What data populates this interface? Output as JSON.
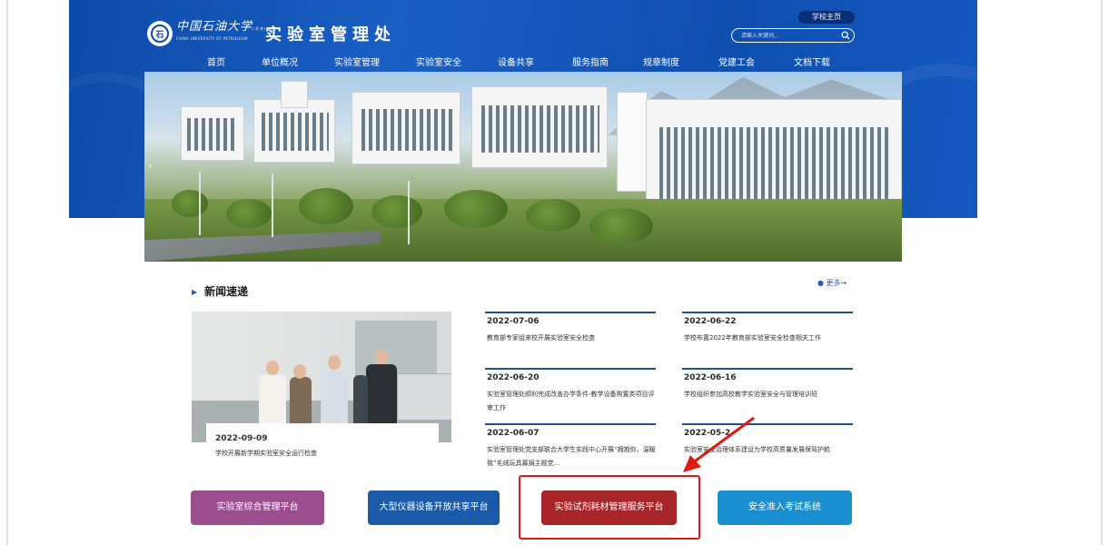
{
  "site": {
    "logo_glyph": "石",
    "university_cn": "中国石油大学",
    "university_tag": "(华东)",
    "university_en": "CHINA UNIVERSITY OF PETROLEUM",
    "department": "实验室管理处",
    "home_link": "学校主页",
    "search_placeholder": "请输入关键词..."
  },
  "nav": [
    "首页",
    "单位概况",
    "实验室管理",
    "实验室安全",
    "设备共享",
    "服务指南",
    "规章制度",
    "党建工会",
    "文档下载"
  ],
  "news": {
    "section_title": "新闻速递",
    "more_label": "更多→",
    "featured": {
      "date": "2022-09-09",
      "title": "学校开展新学期实验室安全运行检查"
    },
    "items": [
      {
        "date": "2022-07-06",
        "title": "教育部专家组来校开展实验室安全检查"
      },
      {
        "date": "2022-06-22",
        "title": "学校布置2022年教育部实验室安全检查相关工作"
      },
      {
        "date": "2022-06-20",
        "title": "实验室管理处顺利完成改善办学条件-教学设备购置类项目评审工作"
      },
      {
        "date": "2022-06-16",
        "title": "学校组织参加高校教学实验室安全与管理培训班"
      },
      {
        "date": "2022-06-07",
        "title": "实验室管理处党支部联合大学生实践中心开展“拥抱你，温暖我”毛绒玩具募捐主题党..."
      },
      {
        "date": "2022-05-2",
        "title": "实验室安全治理体系建设为学校高质量发展保驾护航"
      }
    ]
  },
  "platforms": [
    {
      "label": "实验室综合管理平台",
      "color": "#9b4e8f"
    },
    {
      "label": "大型仪器设备开放共享平台",
      "color": "#1b5aa8"
    },
    {
      "label": "实验试剂耗材管理服务平台",
      "color": "#a8262a"
    },
    {
      "label": "安全准入考试系统",
      "color": "#1a8fd0"
    }
  ],
  "annotation_color": "#e01b14"
}
